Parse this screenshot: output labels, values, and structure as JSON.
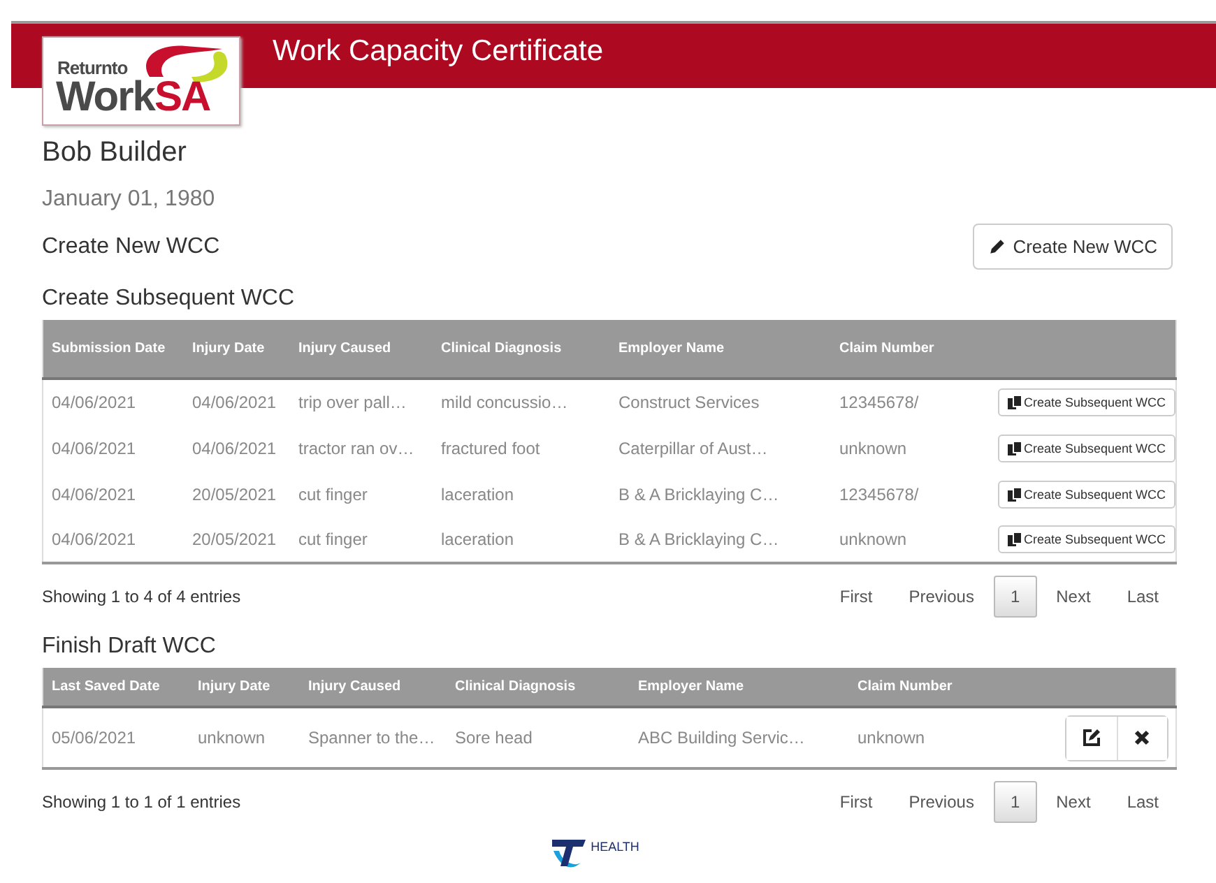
{
  "header": {
    "title": "Work Capacity Certificate",
    "logo": {
      "line_1": "Returnto",
      "line_2_dark": "Work",
      "line_2_red": "SA"
    }
  },
  "patient": {
    "name": "Bob Builder",
    "dob": "January 01, 1980"
  },
  "create_new": {
    "heading": "Create New WCC",
    "button": "Create New WCC"
  },
  "subsequent": {
    "heading": "Create Subsequent WCC",
    "columns": [
      "Submission Date",
      "Injury Date",
      "Injury Caused",
      "Clinical Diagnosis",
      "Employer Name",
      "Claim Number"
    ],
    "rows": [
      {
        "cells": [
          "04/06/2021",
          "04/06/2021",
          "trip over pall…",
          "mild concussio…",
          "Construct Services",
          "12345678/"
        ],
        "action": "Create Subsequent WCC"
      },
      {
        "cells": [
          "04/06/2021",
          "04/06/2021",
          "tractor ran ov…",
          "fractured foot",
          "Caterpillar of Aust…",
          "unknown"
        ],
        "action": "Create Subsequent WCC"
      },
      {
        "cells": [
          "04/06/2021",
          "20/05/2021",
          "cut finger",
          "laceration",
          "B & A Bricklaying C…",
          "12345678/"
        ],
        "action": "Create Subsequent WCC"
      },
      {
        "cells": [
          "04/06/2021",
          "20/05/2021",
          "cut finger",
          "laceration",
          "B & A Bricklaying C…",
          "unknown"
        ],
        "action": "Create Subsequent WCC"
      }
    ],
    "info": "Showing 1 to 4 of 4 entries",
    "pager": [
      {
        "label": "First",
        "selected": false
      },
      {
        "label": "Previous",
        "selected": false
      },
      {
        "label": "1",
        "selected": true
      },
      {
        "label": "Next",
        "selected": false
      },
      {
        "label": "Last",
        "selected": false
      }
    ]
  },
  "drafts": {
    "heading": "Finish Draft WCC",
    "columns": [
      "Last Saved Date",
      "Injury Date",
      "Injury Caused",
      "Clinical Diagnosis",
      "Employer Name",
      "Claim Number"
    ],
    "rows": [
      {
        "cells": [
          "05/06/2021",
          "unknown",
          "Spanner to the…",
          "Sore head",
          "ABC Building Servic…",
          "unknown"
        ]
      }
    ],
    "info": "Showing 1 to 1 of 1 entries",
    "pager": [
      {
        "label": "First",
        "selected": false
      },
      {
        "label": "Previous",
        "selected": false
      },
      {
        "label": "1",
        "selected": true
      },
      {
        "label": "Next",
        "selected": false
      },
      {
        "label": "Last",
        "selected": false
      }
    ]
  },
  "footer": {
    "brand": "HEALTH"
  }
}
